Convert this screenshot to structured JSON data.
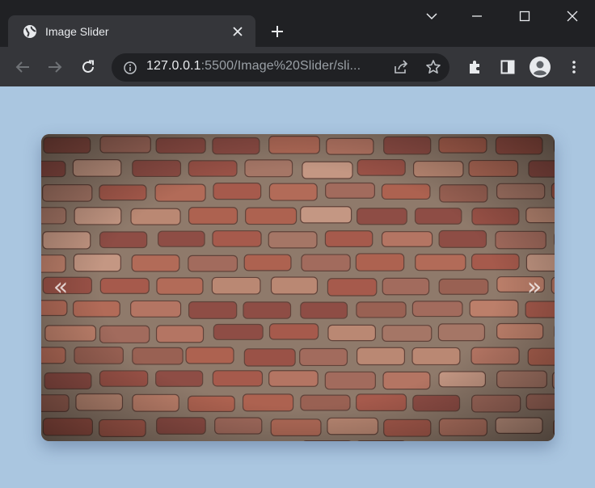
{
  "tab": {
    "title": "Image Slider",
    "favicon": "globe-icon",
    "close_icon": "close-icon"
  },
  "new_tab_icon": "plus-icon",
  "window_controls": [
    "chevron-down-icon",
    "minimize-icon",
    "maximize-icon",
    "close-icon"
  ],
  "nav": {
    "back": "back-arrow-icon",
    "forward": "forward-arrow-icon",
    "reload": "reload-icon"
  },
  "address_bar": {
    "host": "127.0.0.1",
    "path": ":5500/Image%20Slider/sli...",
    "info_icon": "info-icon"
  },
  "omnibox_actions": [
    "share-icon",
    "bookmark-star-icon"
  ],
  "toolbar_icons": [
    "extensions-icon",
    "side-panel-icon",
    "profile-avatar-icon",
    "more-menu-icon"
  ],
  "slider": {
    "image": "brick-wall-photo",
    "prev_label": "«",
    "next_label": "»"
  },
  "colors": {
    "page_background": "#aac6e0",
    "browser_frame": "#202124",
    "toolbar": "#35363a"
  }
}
